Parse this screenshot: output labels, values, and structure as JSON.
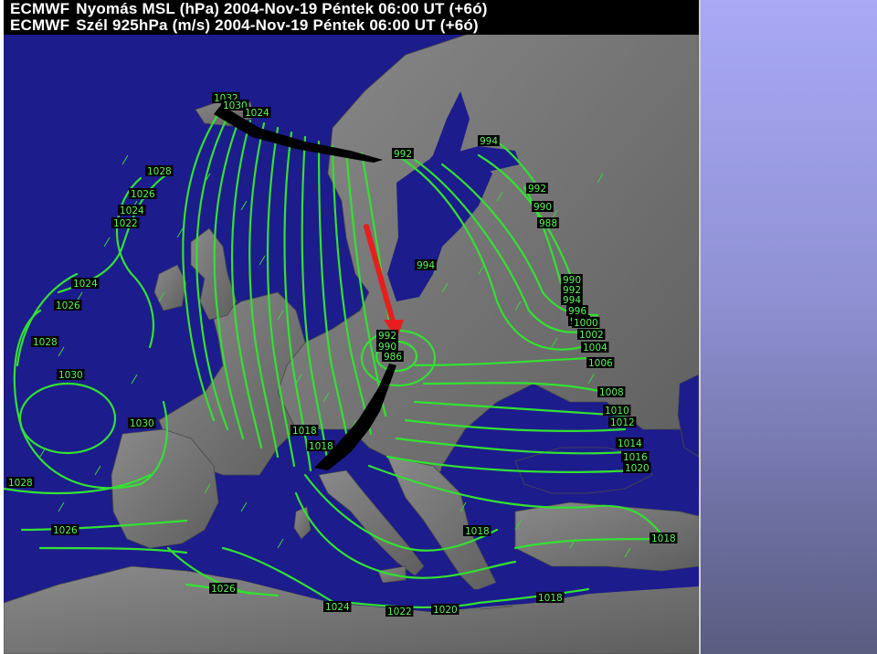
{
  "header": {
    "line1_source": "ECMWF",
    "line1_text": "Nyomás MSL (hPa)   2004-Nov-19 Péntek 06:00 UT (+6ó)",
    "line2_source": "ECMWF",
    "line2_text": "Szél 925hPa (m/s)   2004-Nov-19 Péntek 06:00 UT (+6ó)"
  },
  "colors": {
    "ocean": "#1c1c8c",
    "land": "#6e6e6e",
    "isobar": "#33e033",
    "label_text": "#5cf55c",
    "arrow": "#e81e1e",
    "side_panel": "#9a9ce6"
  },
  "isobar_labels": [
    {
      "text": "1032",
      "id": "l1032a"
    },
    {
      "text": "1030",
      "id": "l1030a"
    },
    {
      "text": "1024",
      "id": "l1024a"
    },
    {
      "text": "1028",
      "id": "l1028a"
    },
    {
      "text": "1026",
      "id": "l1026a"
    },
    {
      "text": "1024",
      "id": "l1024b"
    },
    {
      "text": "1022",
      "id": "l1022a"
    },
    {
      "text": "1024",
      "id": "l1024c"
    },
    {
      "text": "1026",
      "id": "l1026b"
    },
    {
      "text": "1028",
      "id": "l1028b"
    },
    {
      "text": "1030",
      "id": "l1030b"
    },
    {
      "text": "1030",
      "id": "l1030c"
    },
    {
      "text": "1028",
      "id": "l1028c"
    },
    {
      "text": "1026",
      "id": "l1026c"
    },
    {
      "text": "1026",
      "id": "l1026d"
    },
    {
      "text": "1024",
      "id": "l1024d"
    },
    {
      "text": "1022",
      "id": "l1022b"
    },
    {
      "text": "1020",
      "id": "l1020a"
    },
    {
      "text": "1018",
      "id": "l1018a"
    },
    {
      "text": "1018",
      "id": "l1018b"
    },
    {
      "text": "1018",
      "id": "l1018c"
    },
    {
      "text": "1018",
      "id": "l1018d"
    },
    {
      "text": "994",
      "id": "l994a"
    },
    {
      "text": "992",
      "id": "l992a"
    },
    {
      "text": "992",
      "id": "l992b"
    },
    {
      "text": "990",
      "id": "l990a"
    },
    {
      "text": "988",
      "id": "l988a"
    },
    {
      "text": "994",
      "id": "l994b"
    },
    {
      "text": "990",
      "id": "l990b"
    },
    {
      "text": "992",
      "id": "l992c"
    },
    {
      "text": "994",
      "id": "l994c"
    },
    {
      "text": "996",
      "id": "l996a"
    },
    {
      "text": "998",
      "id": "l998a"
    },
    {
      "text": "1000",
      "id": "l1000a"
    },
    {
      "text": "1002",
      "id": "l1002a"
    },
    {
      "text": "1004",
      "id": "l1004a"
    },
    {
      "text": "1006",
      "id": "l1006a"
    },
    {
      "text": "1008",
      "id": "l1008a"
    },
    {
      "text": "1010",
      "id": "l1010a"
    },
    {
      "text": "1012",
      "id": "l1012a"
    },
    {
      "text": "1014",
      "id": "l1014a"
    },
    {
      "text": "1016",
      "id": "l1016a"
    },
    {
      "text": "1020",
      "id": "l1020b"
    },
    {
      "text": "1018",
      "id": "l1018e"
    },
    {
      "text": "992",
      "id": "l992d"
    },
    {
      "text": "990",
      "id": "l990c"
    },
    {
      "text": "986",
      "id": "l986a"
    }
  ]
}
